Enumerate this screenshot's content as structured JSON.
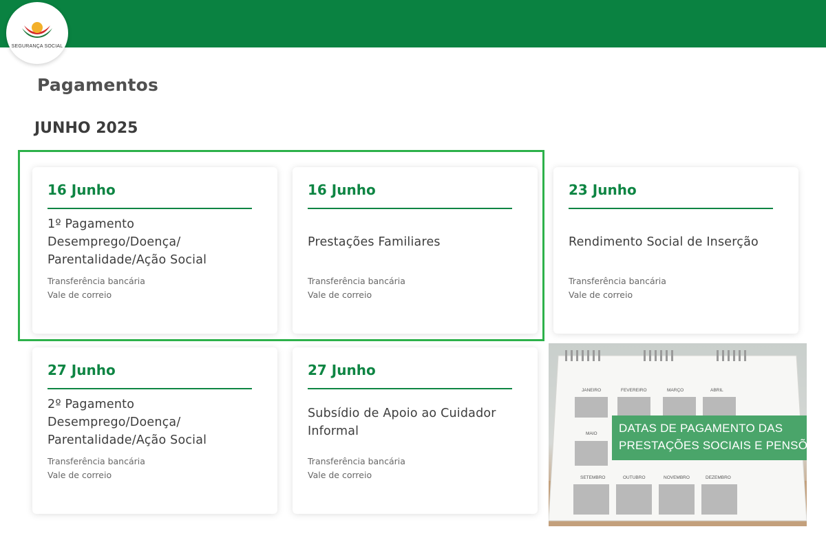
{
  "brand": {
    "logo_text": "SEGURANÇA SOCIAL"
  },
  "page": {
    "title": "Pagamentos",
    "month": "JUNHO 2025"
  },
  "cards": [
    {
      "date": "16 Junho",
      "title_lines": [
        "1º Pagamento",
        "Desemprego/Doença/",
        "Parentalidade/Ação Social"
      ],
      "methods": [
        "Transferência bancária",
        "Vale de correio"
      ]
    },
    {
      "date": "16 Junho",
      "title_lines": [
        "Prestações Familiares"
      ],
      "methods": [
        "Transferência bancária",
        "Vale de correio"
      ]
    },
    {
      "date": "23 Junho",
      "title_lines": [
        "Rendimento Social de Inserção"
      ],
      "methods": [
        "Transferência bancária",
        "Vale de correio"
      ]
    },
    {
      "date": "27 Junho",
      "title_lines": [
        "2º Pagamento",
        "Desemprego/Doença/",
        "Parentalidade/Ação Social"
      ],
      "methods": [
        "Transferência bancária",
        "Vale de correio"
      ]
    },
    {
      "date": "27 Junho",
      "title_lines": [
        "Subsídio de Apoio ao Cuidador",
        "Informal"
      ],
      "methods": [
        "Transferência bancária",
        "Vale de correio"
      ]
    }
  ],
  "promo": {
    "banner_lines": [
      "DATAS DE PAGAMENTO DAS",
      "PRESTAÇÕES SOCIAIS E PENSÕES"
    ],
    "calendar_months": [
      "JANEIRO",
      "FEVEREIRO",
      "MARÇO",
      "ABRIL",
      "MAIO",
      "SETEMBRO",
      "OUTUBRO",
      "NOVEMBRO",
      "DEZEMBRO"
    ]
  },
  "colors": {
    "header_green": "#0a8241",
    "accent_green": "#0e8543",
    "highlight_border": "#2db14a",
    "banner_green": "#4aa56a"
  },
  "icons": {
    "logo": "seguranca-social-logo"
  }
}
